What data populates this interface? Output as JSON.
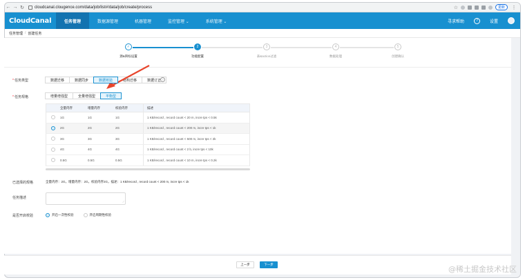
{
  "browser": {
    "url": "cloudcanal.clougence.com/data/job/list#/data/job/create/process",
    "update_label": "更新"
  },
  "app": {
    "logo": "CloudCanal",
    "nav": [
      "任务管理",
      "数据源管理",
      "机器管理",
      "监控管理 ⌄",
      "系统管理 ⌄"
    ],
    "help_label": "寻求帮助",
    "user_label": "设置"
  },
  "breadcrumb": [
    "任务管理",
    "创建任务"
  ],
  "steps": [
    {
      "num": "✓",
      "label": "源&目标设置"
    },
    {
      "num": "2",
      "label": "功能配置"
    },
    {
      "num": "3",
      "label": "表&action过滤"
    },
    {
      "num": "4",
      "label": "数据处理"
    },
    {
      "num": "5",
      "label": "创建确认"
    }
  ],
  "form": {
    "task_type_label": "任务类型",
    "task_types": [
      "数据迁移",
      "数据同步",
      "数据校验",
      "结构迁移",
      "数据订正"
    ],
    "task_type_selected": 2,
    "spec_label": "任务规格",
    "spec_tabs": [
      "增量增强型",
      "全量增强型",
      "平衡型"
    ],
    "spec_tab_selected": 2,
    "table_headers": [
      "全量内存",
      "增量内存",
      "校验内存",
      "描述"
    ],
    "table_rows": [
      {
        "full": "1G",
        "incr": "1G",
        "check": "1G",
        "desc": "1 KB/record , record count < 20 m, incre tps < 0.5k"
      },
      {
        "full": "2G",
        "incr": "2G",
        "check": "2G",
        "desc": "1 KB/record , record count < 200 m, incre tps < 1k"
      },
      {
        "full": "3G",
        "incr": "3G",
        "check": "3G",
        "desc": "1 KB/record , record count < 500 m, incre tps < 2k"
      },
      {
        "full": "4G",
        "incr": "4G",
        "check": "4G",
        "desc": "1 KB/record , record count < 2 b, incre tps < 10k"
      },
      {
        "full": "0.5G",
        "incr": "0.5G",
        "check": "0.5G",
        "desc": "1 KB/record , record count < 10 m, incre tps < 0.2k"
      }
    ],
    "selected_row": 1,
    "selected_spec_label": "已选择的规格",
    "selected_spec_value": "全量内存：2G，增量内存：2G，校验内存2G，描述：1 KB/record , record count < 200 m, incre tps < 1k",
    "desc_label": "任务描述",
    "desc_value": "",
    "check_label": "是否开启校验",
    "check_options": [
      "开启一次性校验",
      "开启周期性校验"
    ],
    "check_selected": 0
  },
  "footer": {
    "prev_label": "上一步",
    "next_label": "下一步"
  },
  "watermark": "@稀土掘金技术社区",
  "colors": {
    "brand": "#1890d0",
    "arrow": "#e8452c"
  }
}
